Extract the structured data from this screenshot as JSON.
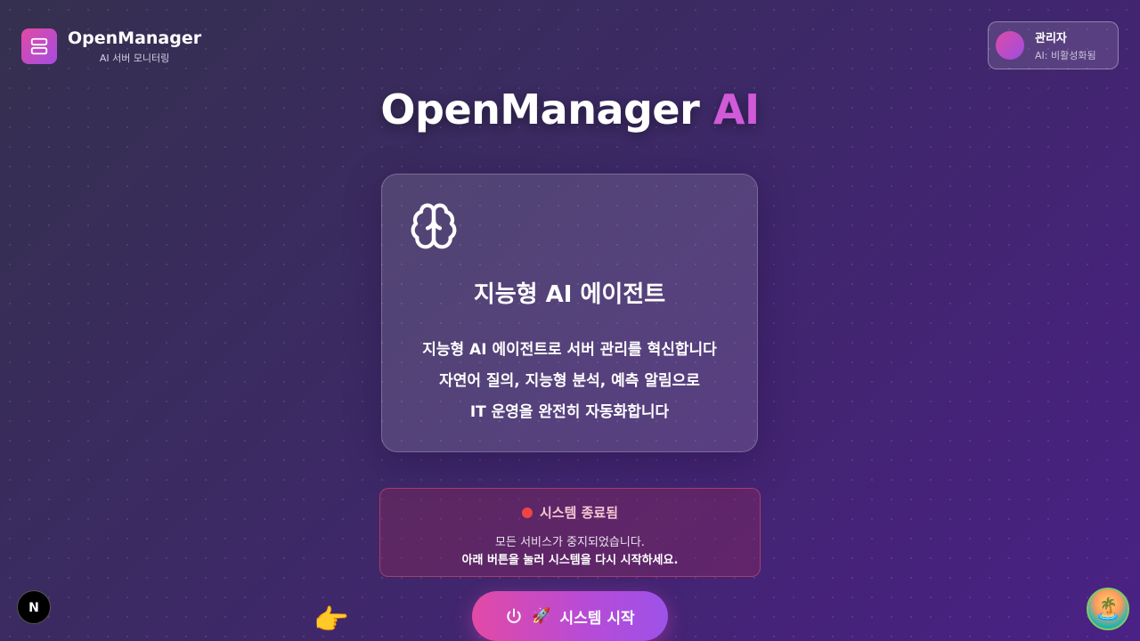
{
  "header": {
    "brand_title": "OpenManager",
    "brand_subtitle": "AI 서버 모니터링",
    "user_name": "관리자",
    "user_status": "AI: 비활성화됨"
  },
  "hero": {
    "title_main": "OpenManager",
    "title_accent": "AI"
  },
  "feature_card": {
    "icon": "brain-icon",
    "title": "지능형 AI 에이전트",
    "lines": [
      "지능형 AI 에이전트로 서버 관리를 혁신합니다",
      "자연어 질의, 지능형 분석, 예측 알림으로",
      "IT 운영을 완전히 자동화합니다"
    ]
  },
  "status": {
    "title": "시스템 종료됨",
    "message_line1": "모든 서비스가 중지되었습니다.",
    "message_line2": "아래 버튼을 눌러 시스템을 다시 시작하세요.",
    "color": "#ef4444"
  },
  "start_button": {
    "rocket": "🚀",
    "label": "시스템 시작"
  },
  "decor": {
    "pointer": "👉",
    "island": "🏝️",
    "next_letter": "N"
  },
  "colors": {
    "accent": "#d05ad8",
    "button_start": "#e24aa6",
    "button_end": "#9d52e8"
  }
}
